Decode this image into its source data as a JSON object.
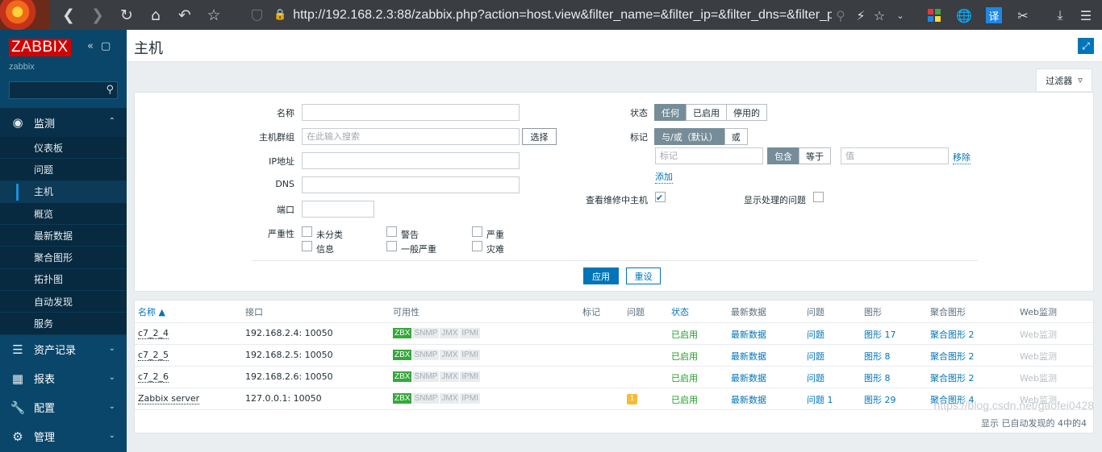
{
  "browser": {
    "url": "http://192.168.2.3:88/zabbix.php?action=host.view&filter_name=&filter_ip=&filter_dns=&filter_po",
    "translate_label": "译"
  },
  "sidebar": {
    "brand": "ZABBIX",
    "server_name": "zabbix",
    "search_placeholder": "",
    "menus": [
      {
        "label": "监测",
        "icon": "eye-icon"
      },
      {
        "label": "资产记录",
        "icon": "list-icon"
      },
      {
        "label": "报表",
        "icon": "bar-chart-icon"
      },
      {
        "label": "配置",
        "icon": "wrench-icon"
      },
      {
        "label": "管理",
        "icon": "gear-icon"
      }
    ],
    "submenu": [
      "仪表板",
      "问题",
      "主机",
      "概览",
      "最新数据",
      "聚合图形",
      "拓扑图",
      "自动发现",
      "服务"
    ],
    "active_sub": "主机"
  },
  "header": {
    "title": "主机"
  },
  "filter": {
    "tab_label": "过滤器",
    "name_label": "名称",
    "group_label": "主机群组",
    "group_placeholder": "在此输入搜索",
    "select_label": "选择",
    "ip_label": "IP地址",
    "dns_label": "DNS",
    "port_label": "端口",
    "severity_label": "严重性",
    "severities": [
      "未分类",
      "警告",
      "严重",
      "信息",
      "一般严重",
      "灾难"
    ],
    "status_label": "状态",
    "status_options": [
      "任何",
      "已启用",
      "停用的"
    ],
    "status_selected": "任何",
    "tags_label": "标记",
    "tags_ops": [
      "与/或（默认）",
      "或"
    ],
    "tag_placeholder": "标记",
    "tag_match": [
      "包含",
      "等于"
    ],
    "value_placeholder": "值",
    "remove_label": "移除",
    "add_label": "添加",
    "maintenance_label": "查看维修中主机",
    "maintenance_checked": true,
    "suppressed_label": "显示处理的问题",
    "suppressed_checked": false,
    "apply_label": "应用",
    "reset_label": "重设"
  },
  "table": {
    "headers": [
      "名称 ▲",
      "接口",
      "可用性",
      "标记",
      "问题",
      "状态",
      "最新数据",
      "问题",
      "图形",
      "聚合图形",
      "Web监测"
    ],
    "rows": [
      {
        "name": "c7_2_4",
        "interface": "192.168.2.4: 10050",
        "status": "已启用",
        "latest": "最新数据",
        "problems": "问题",
        "graphs": "图形 17",
        "screens": "聚合图形 2",
        "web": "Web监测",
        "problem_badge": ""
      },
      {
        "name": "c7_2_5",
        "interface": "192.168.2.5: 10050",
        "status": "已启用",
        "latest": "最新数据",
        "problems": "问题",
        "graphs": "图形 8",
        "screens": "聚合图形 2",
        "web": "Web监测",
        "problem_badge": ""
      },
      {
        "name": "c7_2_6",
        "interface": "192.168.2.6: 10050",
        "status": "已启用",
        "latest": "最新数据",
        "problems": "问题",
        "graphs": "图形 8",
        "screens": "聚合图形 2",
        "web": "Web监测",
        "problem_badge": ""
      },
      {
        "name": "Zabbix server",
        "interface": "127.0.0.1: 10050",
        "status": "已启用",
        "latest": "最新数据",
        "problems": "问题 1",
        "graphs": "图形 29",
        "screens": "聚合图形 4",
        "web": "Web监测",
        "problem_badge": "1"
      }
    ],
    "availability": [
      "ZBX",
      "SNMP",
      "JMX",
      "IPMI"
    ],
    "footer": "显示 已自动发现的 4中的4"
  },
  "watermark": "https://blog.csdn.net/gaofei0428",
  "colors": {
    "sidebar": "#0a466a",
    "brand": "#d40000",
    "link": "#0275b8",
    "enabled": "#1f9c26",
    "zbx": "#34a83b"
  }
}
